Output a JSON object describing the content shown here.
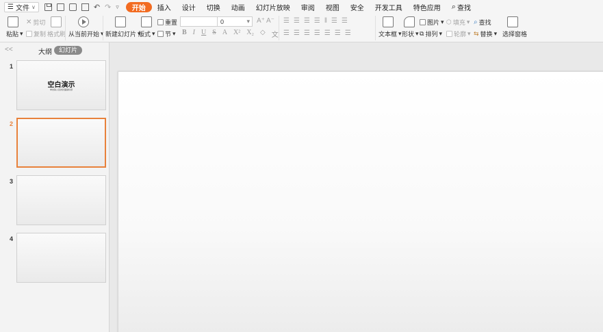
{
  "menubar": {
    "file_label": "文件",
    "tabs": [
      "开始",
      "插入",
      "设计",
      "切换",
      "动画",
      "幻灯片放映",
      "审阅",
      "视图",
      "安全",
      "开发工具",
      "特色应用"
    ],
    "active_tab": "开始",
    "search_label": "查找"
  },
  "ribbon": {
    "paste": "粘贴",
    "cut": "剪切",
    "copy": "复制",
    "format_painter": "格式刷",
    "play_from_current": "从当前开始",
    "new_slide": "新建幻灯片",
    "layout": "版式",
    "reset": "重置",
    "section": "节",
    "font_size_value": "0",
    "text_box": "文本框",
    "shape": "形状",
    "picture": "图片",
    "fill": "填充",
    "arrange": "排列",
    "outline": "轮廓",
    "find": "查找",
    "replace": "替换",
    "select_pane": "选择窗格"
  },
  "panel": {
    "collapse_symbol": "<<",
    "tab_outline": "大纲",
    "tab_slides": "幻灯片",
    "slides": [
      {
        "num": "1",
        "title": "空白演示",
        "subtitle": "单击输入您的封面副标题"
      },
      {
        "num": "2"
      },
      {
        "num": "3"
      },
      {
        "num": "4"
      }
    ],
    "selected_slide": "2"
  },
  "colors": {
    "accent": "#f26b21",
    "selection": "#e8813a"
  }
}
